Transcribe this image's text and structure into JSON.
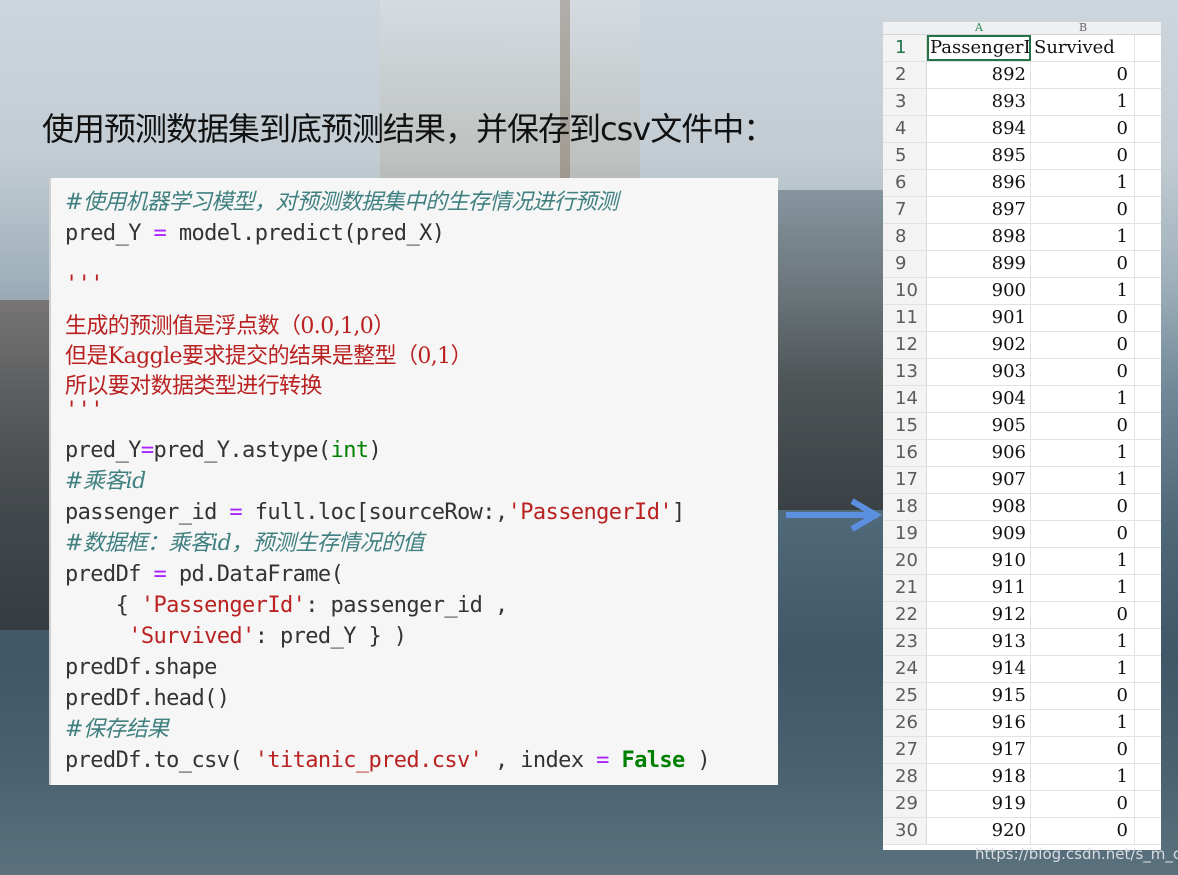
{
  "heading": "使用预测数据集到底预测结果，并保存到csv文件中：",
  "code": {
    "comment_top": "#使用机器学习模型，对预测数据集中的生存情况进行预测",
    "line_predict": {
      "a": "pred_Y ",
      "op": "=",
      "b": " model.predict(pred_X)"
    },
    "docstring_open": "'''",
    "doc1": "生成的预测值是浮点数（0.0,1,0）",
    "doc2": "但是Kaggle要求提交的结果是整型（0,1）",
    "doc3": "所以要对数据类型进行转换",
    "docstring_close": "'''",
    "line_astype": {
      "a": "pred_Y",
      "op": "=",
      "b": "pred_Y.astype(",
      "builtin": "int",
      "c": ")"
    },
    "comment_id": "#乘客id",
    "line_pid": {
      "a": "passenger_id ",
      "op": "=",
      "b": " full.loc[sourceRow:,",
      "str": "'PassengerId'",
      "c": "]"
    },
    "comment_df": "#数据框：乘客id，预测生存情况的值",
    "line_df": {
      "a": "predDf ",
      "op": "=",
      "b": " pd.DataFrame("
    },
    "line_dict1": {
      "a": "    { ",
      "str": "'PassengerId'",
      "b": ": passenger_id ,"
    },
    "line_dict2": {
      "a": "     ",
      "str": "'Survived'",
      "b": ": pred_Y } )"
    },
    "line_shape": "predDf.shape",
    "line_head": "predDf.head()",
    "comment_save": "#保存结果",
    "line_csv": {
      "a": "predDf.to_csv( ",
      "str": "'titanic_pred.csv'",
      "b": " , index ",
      "op": "=",
      "kw": "False",
      "c": " )"
    }
  },
  "spreadsheet": {
    "col_headers": [
      "A",
      "B"
    ],
    "header_row": {
      "num": "1",
      "a": "PassengerId",
      "b": "Survived"
    },
    "rows": [
      {
        "num": "2",
        "a": "892",
        "b": "0"
      },
      {
        "num": "3",
        "a": "893",
        "b": "1"
      },
      {
        "num": "4",
        "a": "894",
        "b": "0"
      },
      {
        "num": "5",
        "a": "895",
        "b": "0"
      },
      {
        "num": "6",
        "a": "896",
        "b": "1"
      },
      {
        "num": "7",
        "a": "897",
        "b": "0"
      },
      {
        "num": "8",
        "a": "898",
        "b": "1"
      },
      {
        "num": "9",
        "a": "899",
        "b": "0"
      },
      {
        "num": "10",
        "a": "900",
        "b": "1"
      },
      {
        "num": "11",
        "a": "901",
        "b": "0"
      },
      {
        "num": "12",
        "a": "902",
        "b": "0"
      },
      {
        "num": "13",
        "a": "903",
        "b": "0"
      },
      {
        "num": "14",
        "a": "904",
        "b": "1"
      },
      {
        "num": "15",
        "a": "905",
        "b": "0"
      },
      {
        "num": "16",
        "a": "906",
        "b": "1"
      },
      {
        "num": "17",
        "a": "907",
        "b": "1"
      },
      {
        "num": "18",
        "a": "908",
        "b": "0"
      },
      {
        "num": "19",
        "a": "909",
        "b": "0"
      },
      {
        "num": "20",
        "a": "910",
        "b": "1"
      },
      {
        "num": "21",
        "a": "911",
        "b": "1"
      },
      {
        "num": "22",
        "a": "912",
        "b": "0"
      },
      {
        "num": "23",
        "a": "913",
        "b": "1"
      },
      {
        "num": "24",
        "a": "914",
        "b": "1"
      },
      {
        "num": "25",
        "a": "915",
        "b": "0"
      },
      {
        "num": "26",
        "a": "916",
        "b": "1"
      },
      {
        "num": "27",
        "a": "917",
        "b": "0"
      },
      {
        "num": "28",
        "a": "918",
        "b": "1"
      },
      {
        "num": "29",
        "a": "919",
        "b": "0"
      },
      {
        "num": "30",
        "a": "920",
        "b": "0"
      }
    ]
  },
  "arrow": {
    "color": "#5b8fe0",
    "icon": "arrow-right-icon"
  },
  "watermark": "https://blog.csdn.net/s_m_c"
}
